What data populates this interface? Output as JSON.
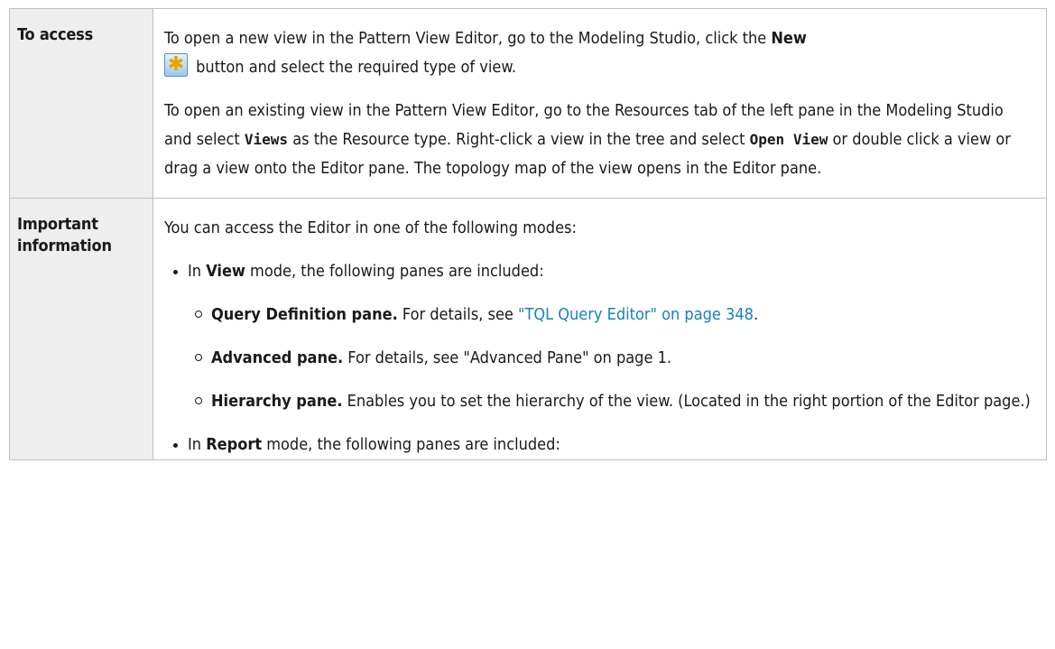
{
  "rows": [
    {
      "label": "To access",
      "p1": {
        "before": "To open a new view in the Pattern View Editor, go to the Modeling Studio, click the ",
        "bold": "New",
        "after": " button and select the required type of view.",
        "icon": "new-star-icon"
      },
      "p2": {
        "t1": "To open an existing view in the Pattern View Editor, go to the Resources tab of the left pane in the Modeling Studio and select ",
        "b1": "Views",
        "t2": " as the Resource type. Right-click a view in the tree and select ",
        "b2": "Open View",
        "t3": " or double click a view or drag a view onto the Editor pane. The topology map of the view opens in the Editor pane."
      }
    },
    {
      "label": "Important information",
      "intro": "You can access the Editor in one of the following modes:",
      "view_mode": {
        "pre": "In ",
        "bold": "View",
        "post": " mode, the following panes are included:",
        "items": [
          {
            "title": "Query Definition pane.",
            "text": " For details, see ",
            "link": "\"TQL Query Editor\" on page 348",
            "tail": "."
          },
          {
            "title": "Advanced pane.",
            "text": " For details, see \"Advanced Pane\" on page 1."
          },
          {
            "title": "Hierarchy pane.",
            "text": " Enables you to set the hierarchy of the view. (Located in the right portion of the Editor page.)"
          }
        ]
      },
      "report_mode": {
        "pre": "In ",
        "bold": "Report",
        "post": " mode, the following panes are included:"
      }
    }
  ],
  "colors": {
    "label_bg": "#eeeeee",
    "border": "#c2c2c2",
    "link": "#1a7fbf"
  }
}
